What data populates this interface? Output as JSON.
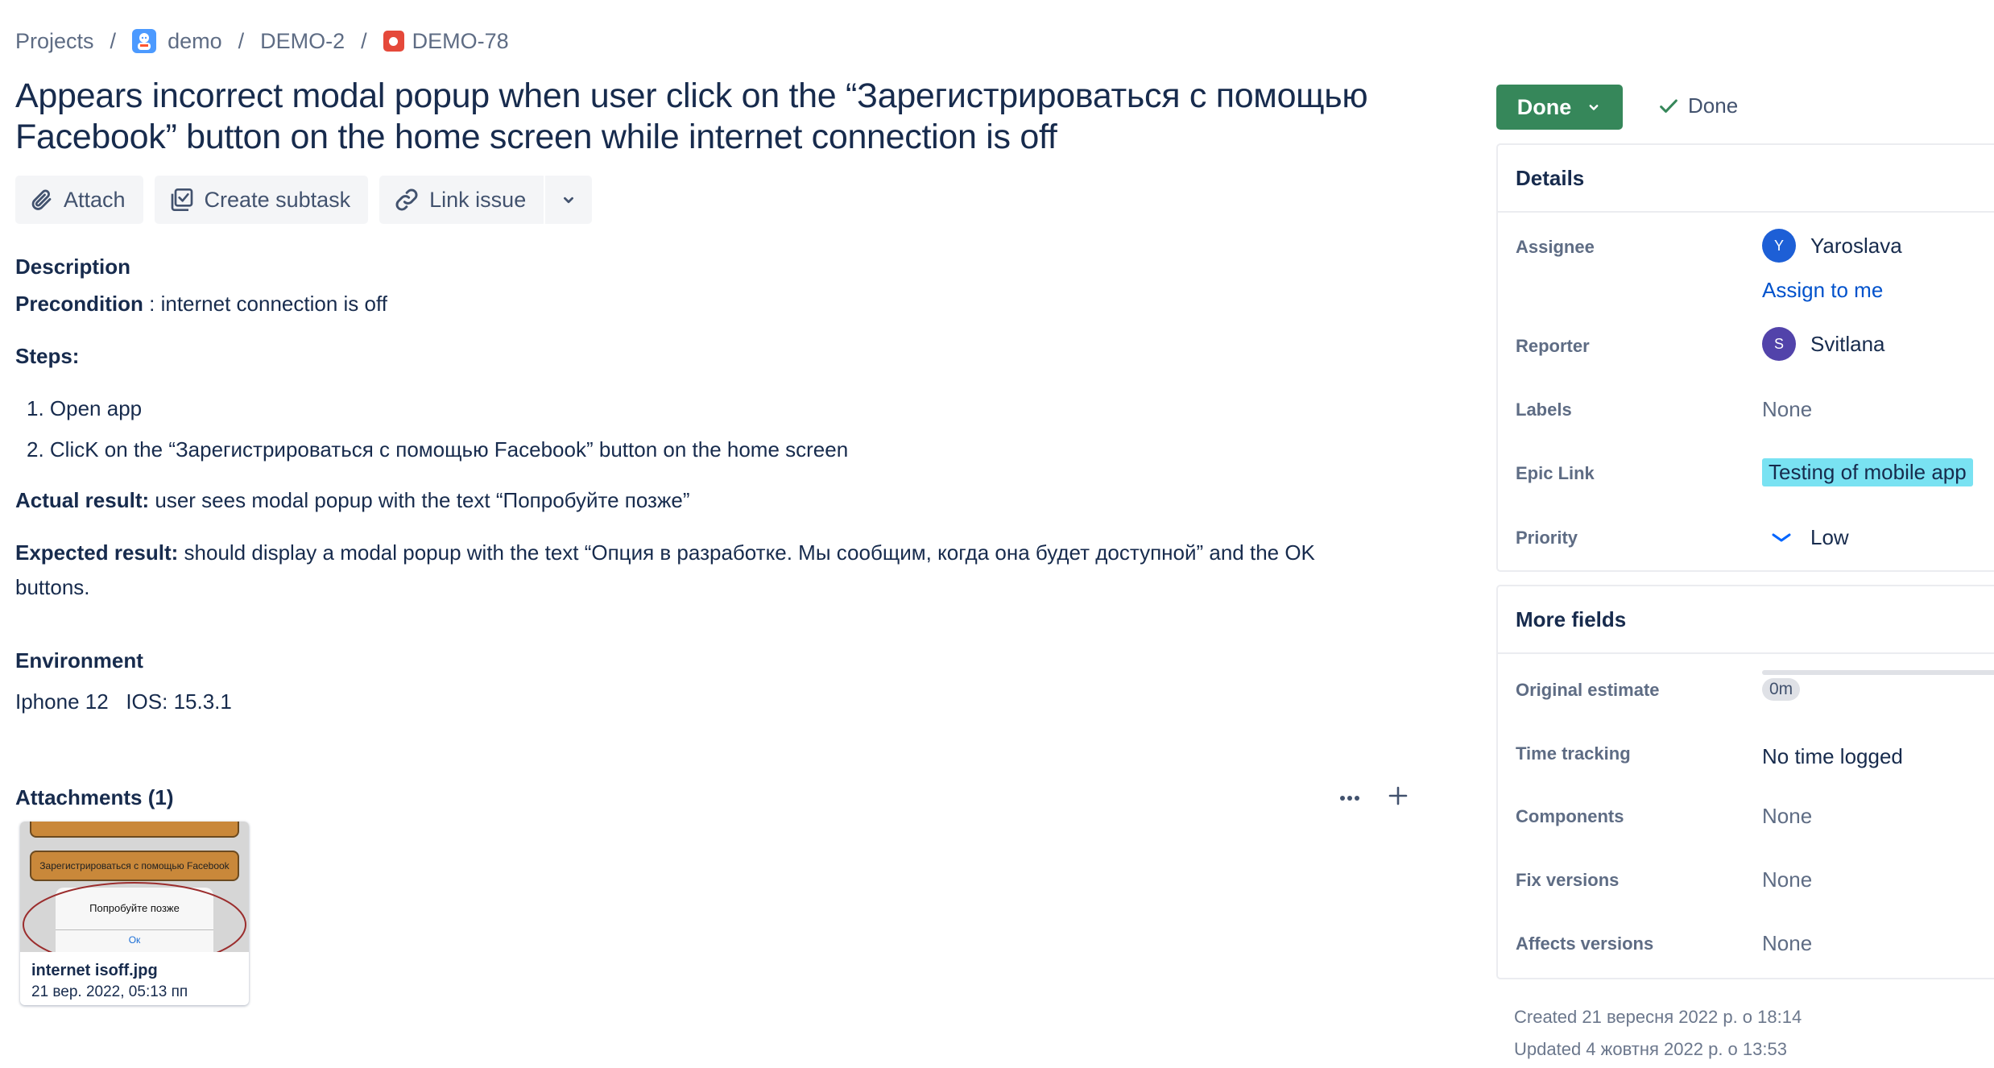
{
  "breadcrumb": {
    "projects": "Projects",
    "project": "demo",
    "parent": "DEMO-2",
    "issue": "DEMO-78",
    "separator": "/"
  },
  "issue": {
    "title": "Appears incorrect modal popup when user click on the “Зарегистрироваться с помощью Facebook” button on the home screen while internet connection is off"
  },
  "toolbar": {
    "attach": "Attach",
    "create_subtask": "Create subtask",
    "link_issue": "Link issue"
  },
  "description": {
    "heading": "Description",
    "precondition_label": "Precondition",
    "precondition_text": " : internet connection is off",
    "steps_label": "Steps:",
    "steps": [
      "1. Open app",
      "2. ClicK on the “Зарегистрироваться с помощью Facebook” button on the home screen"
    ],
    "actual_label": "Actual result:",
    "actual_text": " user sees modal popup with the text “Попробуйте позже”",
    "expected_label": "Expected result:",
    "expected_text_line1": " should display a modal popup with the text “Опция в разработке. Мы сообщим, когда она будет доступной” and the OK",
    "expected_text_line2": "buttons."
  },
  "environment": {
    "heading": "Environment",
    "value": "Iphone 12   IOS: 15.3.1"
  },
  "attachments": {
    "heading": "Attachments (1)",
    "more": "···",
    "add": "+",
    "items": [
      {
        "name": "internet isoff.jpg",
        "date": "21 вер. 2022, 05:13 пп",
        "thumb_button_text": "Зарегистрироваться с помощью Facebook",
        "thumb_modal_text": "Попробуйте позже",
        "thumb_ok": "Ок"
      }
    ]
  },
  "status": {
    "button": "Done",
    "resolution": "Done",
    "color": "#36875a"
  },
  "details": {
    "heading": "Details",
    "assignee_label": "Assignee",
    "assignee_initial": "Y",
    "assignee_name": "Yaroslava",
    "assign_to_me": "Assign to me",
    "reporter_label": "Reporter",
    "reporter_initial": "S",
    "reporter_name": "Svitlana",
    "labels_label": "Labels",
    "labels_value": "None",
    "epic_label": "Epic Link",
    "epic_value": "Testing of mobile app",
    "priority_label": "Priority",
    "priority_value": "Low"
  },
  "more_fields": {
    "heading": "More fields",
    "original_estimate_label": "Original estimate",
    "original_estimate_value": "0m",
    "time_tracking_label": "Time tracking",
    "time_tracking_value": "No time logged",
    "components_label": "Components",
    "components_value": "None",
    "fix_versions_label": "Fix versions",
    "fix_versions_value": "None",
    "affects_versions_label": "Affects versions",
    "affects_versions_value": "None"
  },
  "footer": {
    "created": "Created 21 вересня 2022 р. о 18:14",
    "updated": "Updated 4 жовтня 2022 р. о 13:53"
  }
}
